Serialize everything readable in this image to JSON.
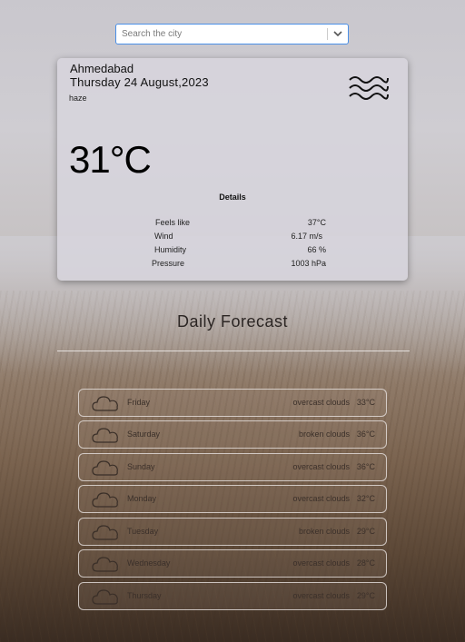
{
  "search": {
    "placeholder": "Search the city"
  },
  "current": {
    "city": "Ahmedabad",
    "date": "Thursday 24 August,2023",
    "condition": "haze",
    "condition_icon": "haze-icon",
    "temperature": "31°C",
    "details_title": "Details",
    "details": [
      {
        "label": "Feels like",
        "value": "37°C"
      },
      {
        "label": "Wind",
        "value": "6.17 m/s"
      },
      {
        "label": "Humidity",
        "value": "66 %"
      },
      {
        "label": "Pressure",
        "value": "1003 hPa"
      }
    ]
  },
  "forecast": {
    "title": "Daily Forecast",
    "days": [
      {
        "day": "Friday",
        "description": "overcast clouds",
        "temp": "33°C",
        "icon": "cloud-icon"
      },
      {
        "day": "Saturday",
        "description": "broken clouds",
        "temp": "36°C",
        "icon": "cloud-icon"
      },
      {
        "day": "Sunday",
        "description": "overcast clouds",
        "temp": "36°C",
        "icon": "cloud-icon"
      },
      {
        "day": "Monday",
        "description": "overcast clouds",
        "temp": "32°C",
        "icon": "cloud-icon"
      },
      {
        "day": "Tuesday",
        "description": "broken clouds",
        "temp": "29°C",
        "icon": "cloud-icon"
      },
      {
        "day": "Wednesday",
        "description": "overcast clouds",
        "temp": "28°C",
        "icon": "cloud-icon"
      },
      {
        "day": "Thursday",
        "description": "overcast clouds",
        "temp": "29°C",
        "icon": "cloud-icon"
      }
    ]
  }
}
